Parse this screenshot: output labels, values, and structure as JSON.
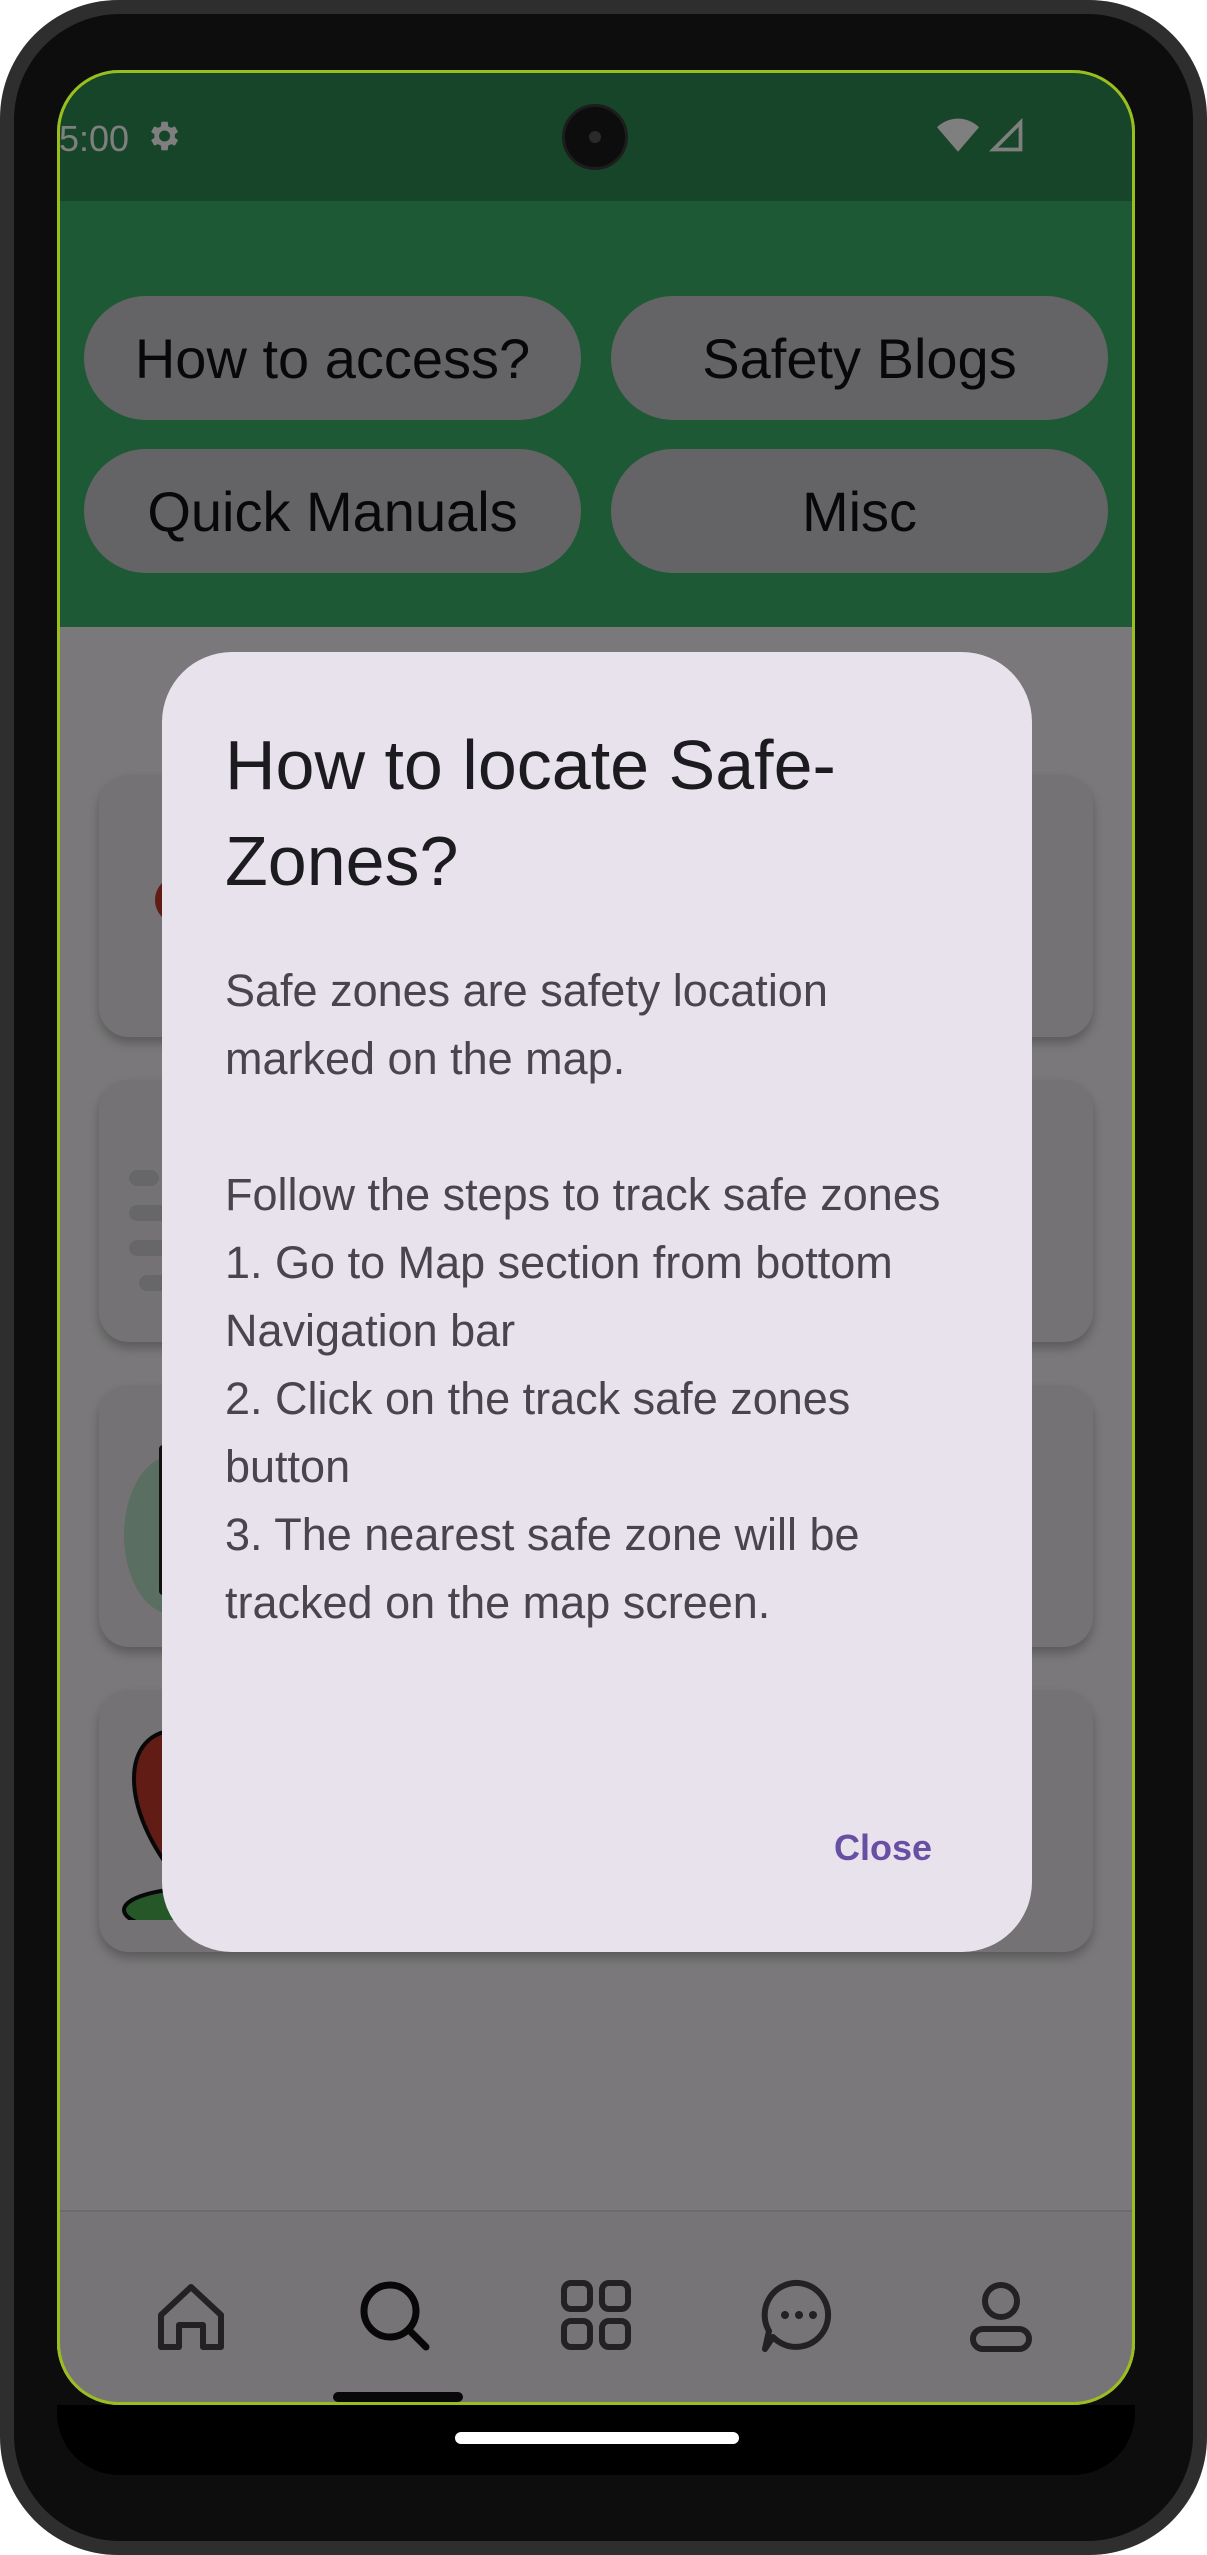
{
  "status_bar": {
    "time": "5:00",
    "settings_icon": "gear-icon",
    "wifi_icon": "wifi-icon",
    "signal_icon": "signal-icon"
  },
  "app_bar": {
    "chips": [
      {
        "label": "How to access?"
      },
      {
        "label": "Safety Blogs"
      },
      {
        "label": "Quick Manuals"
      },
      {
        "label": "Misc"
      }
    ]
  },
  "dialog": {
    "title": "How to locate Safe-Zones?",
    "body": "Safe zones are safety location marked on the map.\n\nFollow the steps to track safe zones\n1. Go to Map section from bottom Navigation bar\n2. Click on the track safe zones button\n3. The nearest safe zone will be tracked on the map screen.",
    "close_label": "Close"
  },
  "bottom_nav": {
    "items": [
      {
        "icon": "home-icon"
      },
      {
        "icon": "search-icon",
        "selected": true
      },
      {
        "icon": "grid-icon"
      },
      {
        "icon": "chat-icon"
      },
      {
        "icon": "profile-icon"
      }
    ]
  },
  "colors": {
    "app_bar": "#3db36a",
    "status_bar": "#2f8a55",
    "dialog_bg": "#e8e2ec",
    "accent": "#6750a4"
  }
}
